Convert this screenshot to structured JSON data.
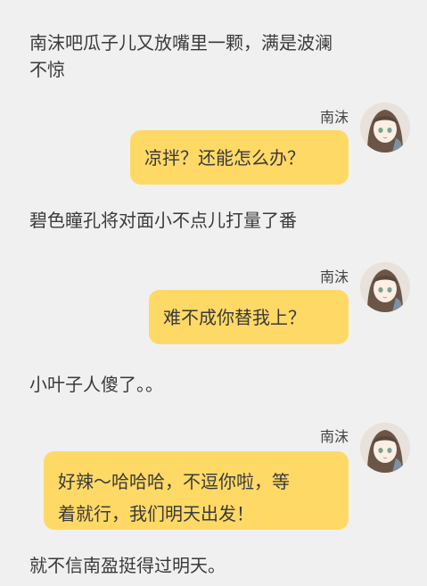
{
  "narration": [
    "南沫吧瓜子儿又放嘴里一颗，满是波澜\n不惊",
    "碧色瞳孔将对面小不点儿打量了番",
    "小叶子人傻了。。",
    "就不信南盈挺得过明天。"
  ],
  "messages": [
    {
      "sender": "南沫",
      "text": "凉拌？还能怎么办？"
    },
    {
      "sender": "南沫",
      "text": "难不成你替我上？"
    },
    {
      "sender": "南沫",
      "text": "好辣～哈哈哈，不逗你啦，等\n着就行，我们明天出发！"
    }
  ],
  "colors": {
    "background": "#f0f0f0",
    "bubble": "#ffd966",
    "text": "#3a3a3a"
  },
  "icons": {
    "avatar": "anime-girl-avatar-icon"
  }
}
